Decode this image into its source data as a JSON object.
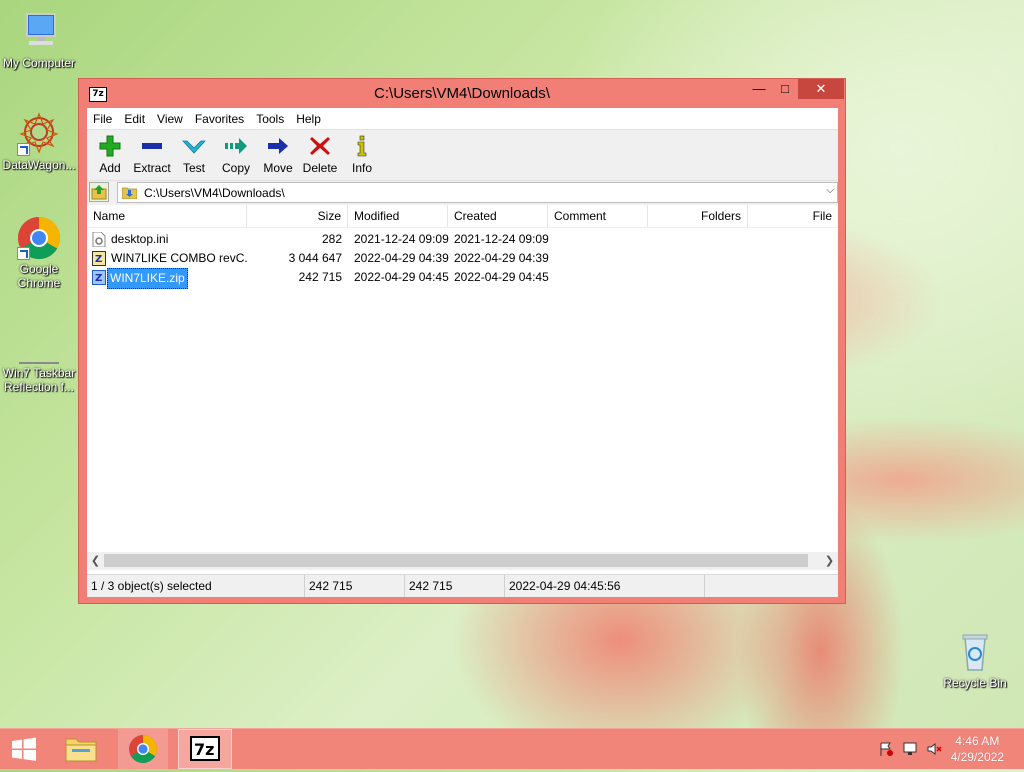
{
  "desktop": {
    "icons": [
      {
        "label": "My Computer"
      },
      {
        "label": "DataWagon..."
      },
      {
        "label": "Google Chrome"
      },
      {
        "label": "Win7 Taskbar Reflection f..."
      },
      {
        "label": "Recycle Bin"
      }
    ]
  },
  "window": {
    "app_icon": "7z",
    "title": "C:\\Users\\VM4\\Downloads\\",
    "controls": {
      "minimize": "—",
      "maximize": "□",
      "close": "✕"
    }
  },
  "menu": [
    "File",
    "Edit",
    "View",
    "Favorites",
    "Tools",
    "Help"
  ],
  "toolbar": [
    {
      "label": "Add",
      "icon": "plus-icon",
      "color": "#22aa22"
    },
    {
      "label": "Extract",
      "icon": "minus-icon",
      "color": "#1a2fa8"
    },
    {
      "label": "Test",
      "icon": "check-icon",
      "color": "#22b3d8"
    },
    {
      "label": "Copy",
      "icon": "copy-arrow-icon",
      "color": "#129a7a"
    },
    {
      "label": "Move",
      "icon": "move-arrow-icon",
      "color": "#1a2fa8"
    },
    {
      "label": "Delete",
      "icon": "delete-x-icon",
      "color": "#cc1111"
    },
    {
      "label": "Info",
      "icon": "info-icon",
      "color": "#c9c200"
    }
  ],
  "address": {
    "path": "C:\\Users\\VM4\\Downloads\\"
  },
  "columns": [
    "Name",
    "Size",
    "Modified",
    "Created",
    "Comment",
    "Folders",
    "File"
  ],
  "files": [
    {
      "name": "desktop.ini",
      "size": "282",
      "modified": "2021-12-24 09:09",
      "created": "2021-12-24 09:09",
      "icon": "ini-file-icon",
      "selected": false
    },
    {
      "name": "WIN7LIKE COMBO revC...",
      "size": "3 044 647",
      "modified": "2022-04-29 04:39",
      "created": "2022-04-29 04:39",
      "icon": "archive-file-icon",
      "selected": false
    },
    {
      "name": "WIN7LIKE.zip",
      "size": "242 715",
      "modified": "2022-04-29 04:45",
      "created": "2022-04-29 04:45",
      "icon": "archive-file-icon",
      "selected": true
    }
  ],
  "status": {
    "selection": "1 / 3 object(s) selected",
    "size": "242 715",
    "packed": "242 715",
    "modified": "2022-04-29 04:45:56"
  },
  "taskbar": {
    "apps": [
      "file-explorer",
      "google-chrome",
      "7-zip"
    ],
    "clock_time": "4:46 AM",
    "clock_date": "4/29/2022"
  },
  "colors": {
    "window_frame": "#f27f75",
    "taskbar": "#f1857a",
    "selection": "#3399ff"
  }
}
